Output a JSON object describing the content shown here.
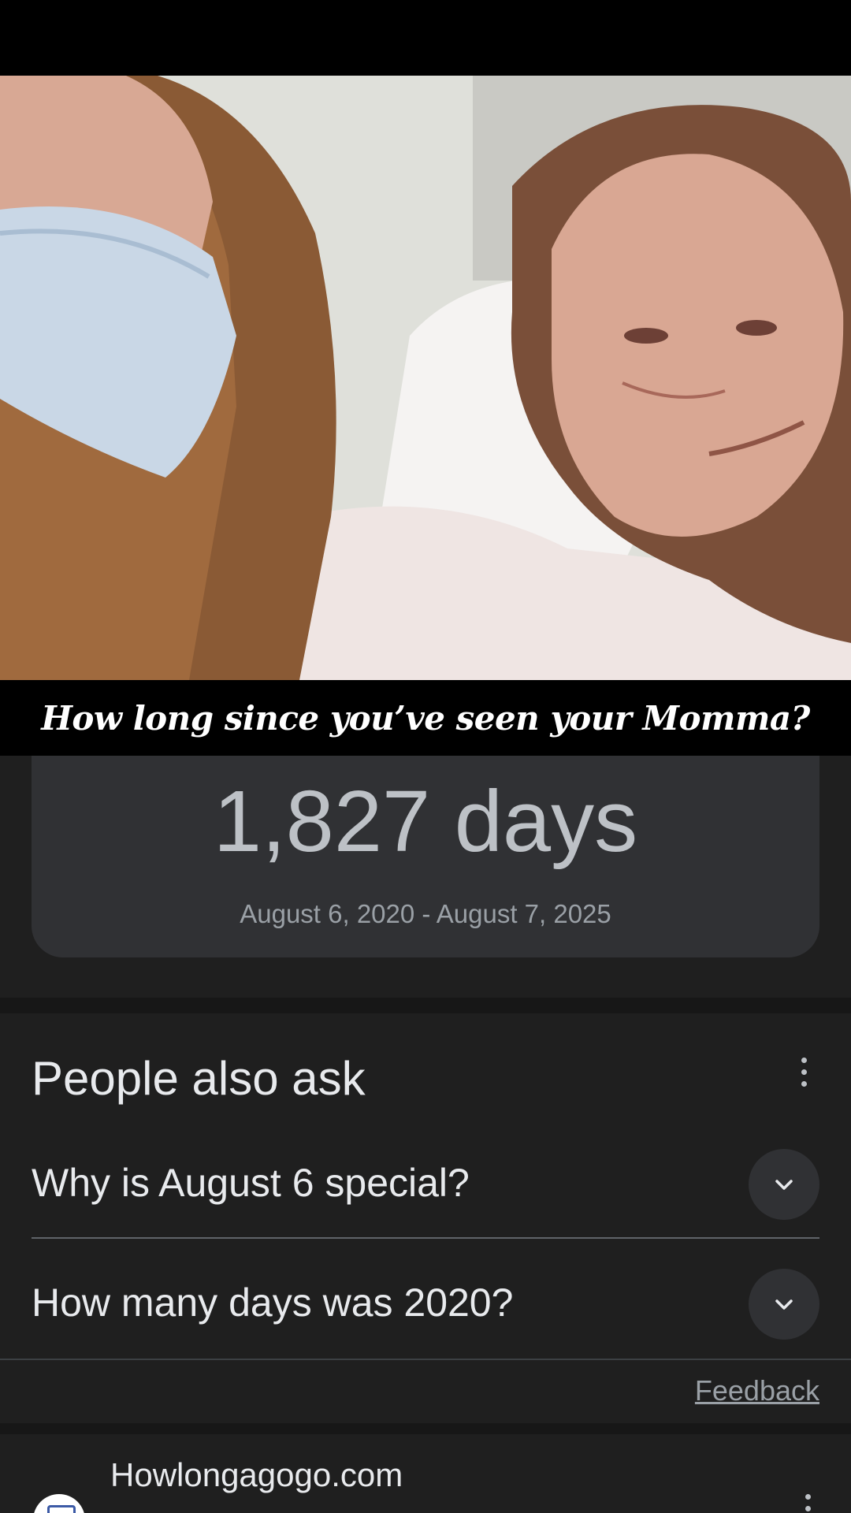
{
  "caption": "How long since you’ve seen your Momma?",
  "result_card": {
    "value": "1,827 days",
    "range": "August 6, 2020 - August 7, 2025"
  },
  "people_also_ask": {
    "title": "People also ask",
    "questions": [
      {
        "text": "Why is August 6 special?"
      },
      {
        "text": "How many days was 2020?"
      }
    ]
  },
  "feedback_label": "Feedback",
  "search_result": {
    "site_name": "Howlongagogo.com"
  },
  "colors": {
    "background": "#1f1f1f",
    "card": "#303134",
    "text_primary": "#e8eaed",
    "text_secondary": "#9aa0a6"
  }
}
